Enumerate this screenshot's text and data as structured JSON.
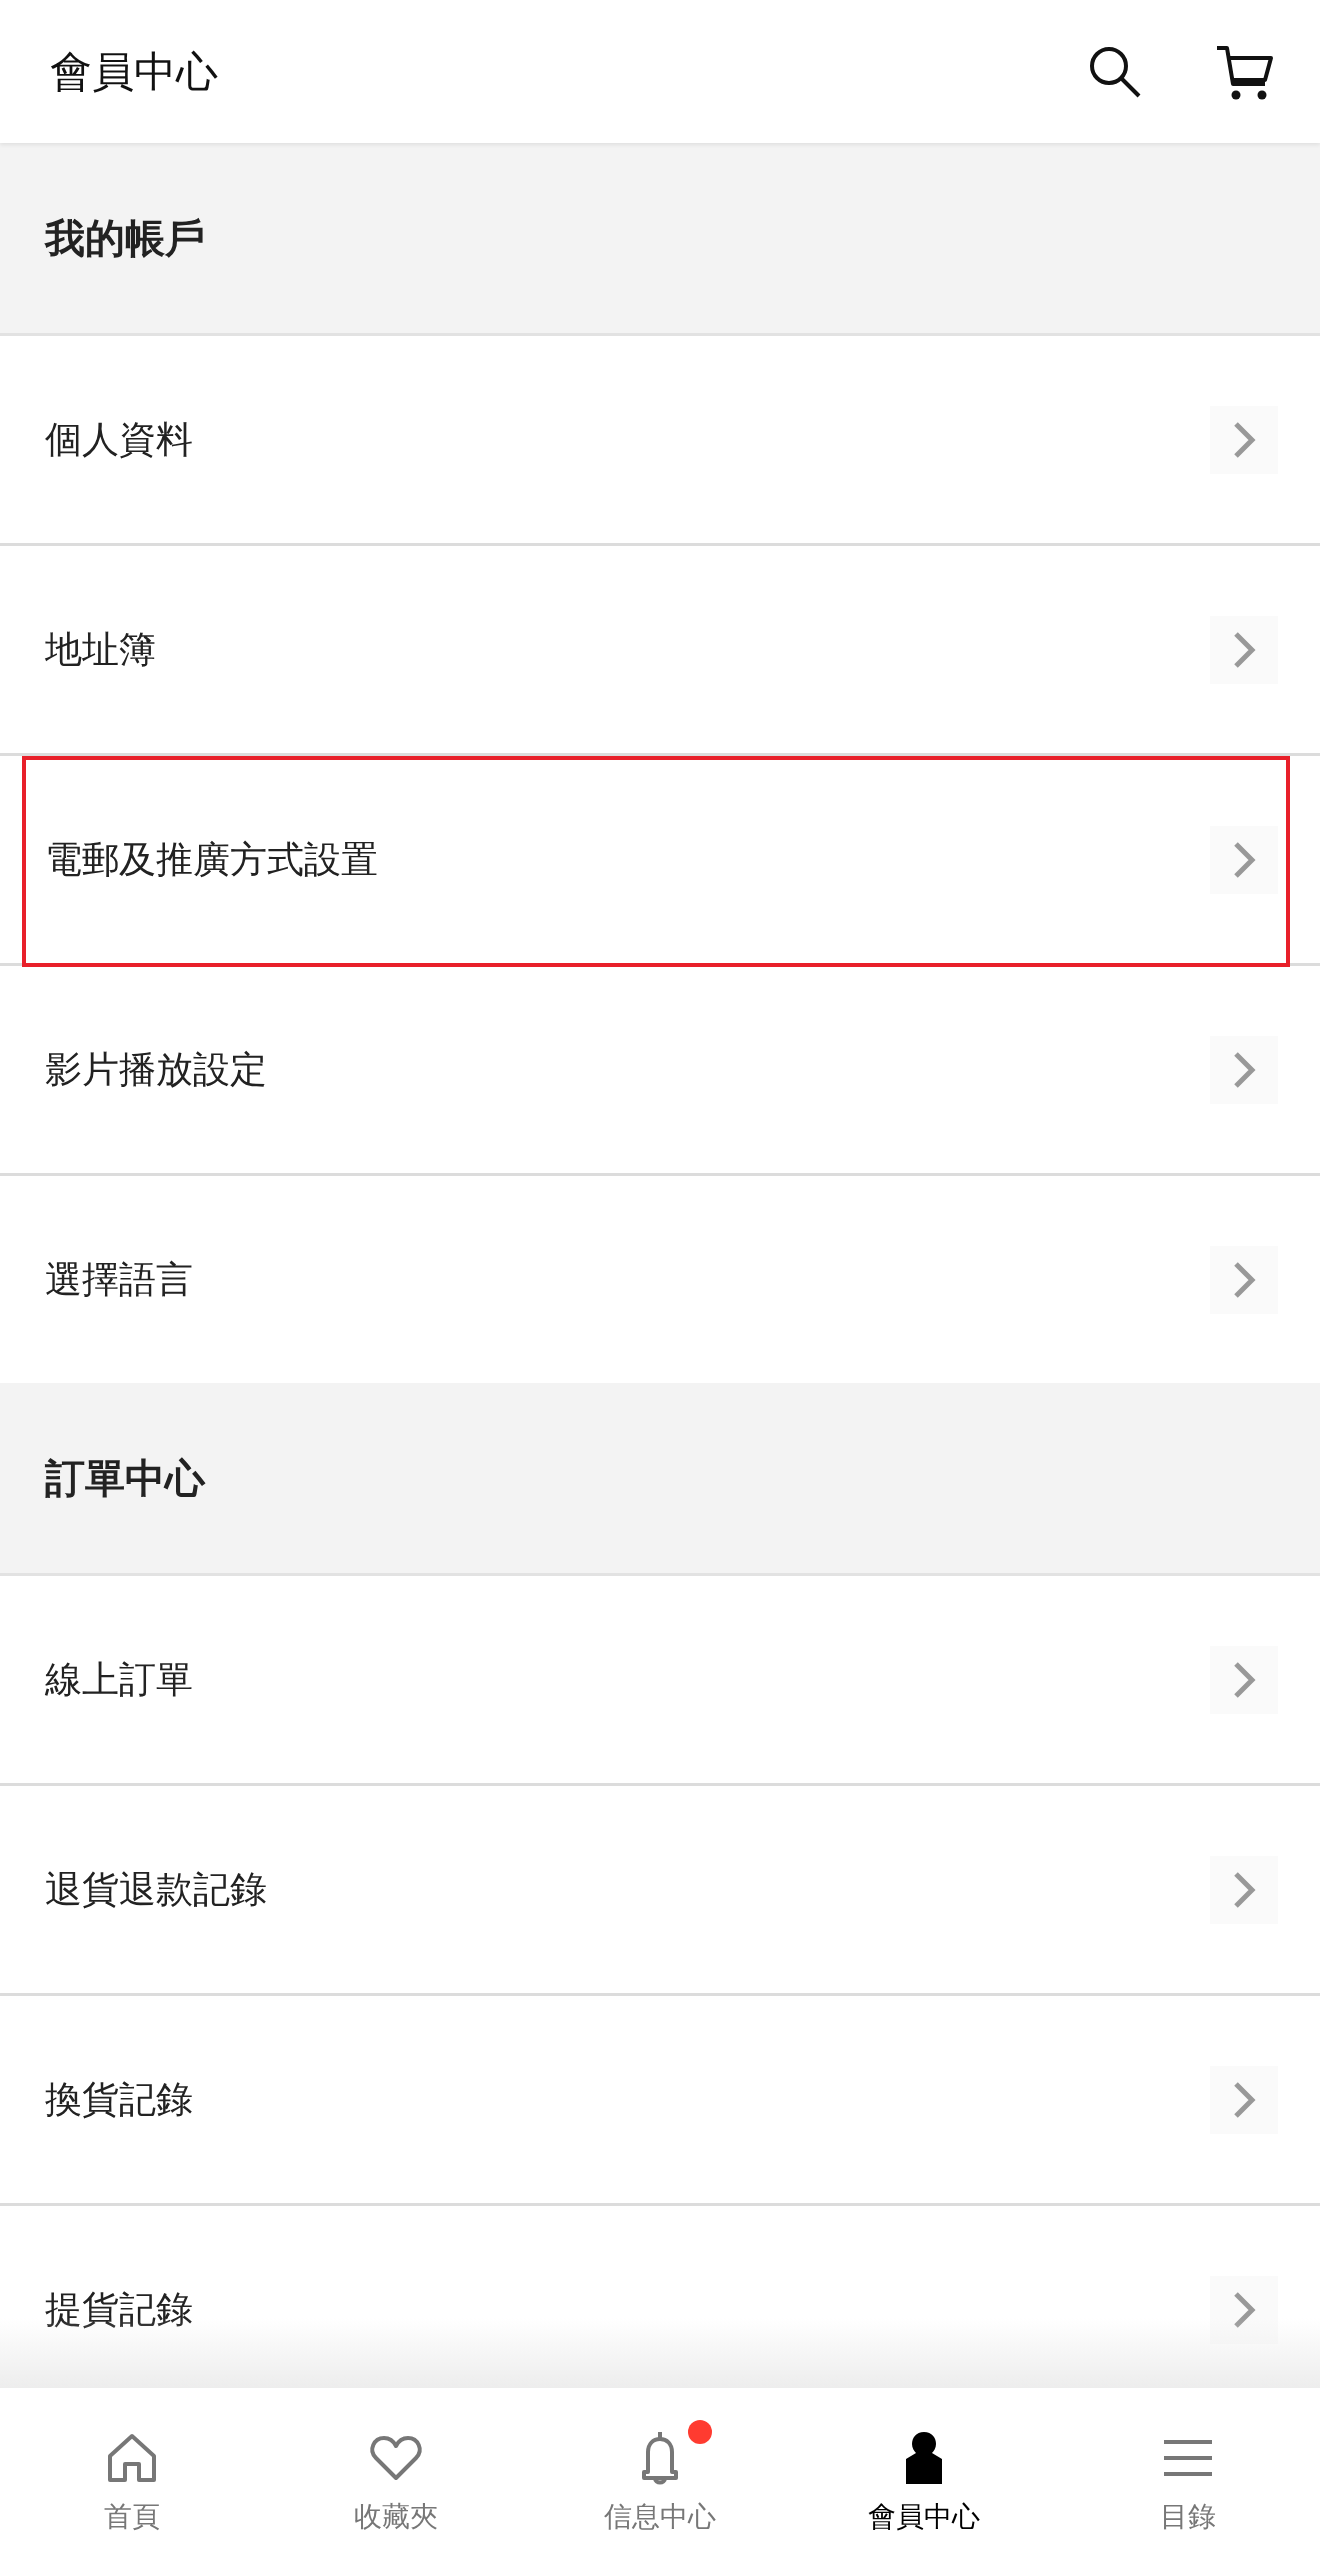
{
  "header": {
    "title": "會員中心"
  },
  "sections": [
    {
      "title": "我的帳戶",
      "items": [
        {
          "label": "個人資料",
          "highlighted": false
        },
        {
          "label": "地址簿",
          "highlighted": false
        },
        {
          "label": "電郵及推廣方式設置",
          "highlighted": true
        },
        {
          "label": "影片播放設定",
          "highlighted": false
        },
        {
          "label": "選擇語言",
          "highlighted": false
        }
      ]
    },
    {
      "title": "訂單中心",
      "items": [
        {
          "label": "線上訂單",
          "highlighted": false
        },
        {
          "label": "退貨退款記錄",
          "highlighted": false
        },
        {
          "label": "換貨記錄",
          "highlighted": false
        },
        {
          "label": "提貨記錄",
          "highlighted": false
        }
      ]
    }
  ],
  "bottom_nav": [
    {
      "kind": "home",
      "label": "首頁",
      "selected": false,
      "badge": false
    },
    {
      "kind": "favorites",
      "label": "收藏夾",
      "selected": false,
      "badge": false
    },
    {
      "kind": "messages",
      "label": "信息中心",
      "selected": false,
      "badge": true
    },
    {
      "kind": "member",
      "label": "會員中心",
      "selected": true,
      "badge": false
    },
    {
      "kind": "catalog",
      "label": "目錄",
      "selected": false,
      "badge": false
    }
  ]
}
